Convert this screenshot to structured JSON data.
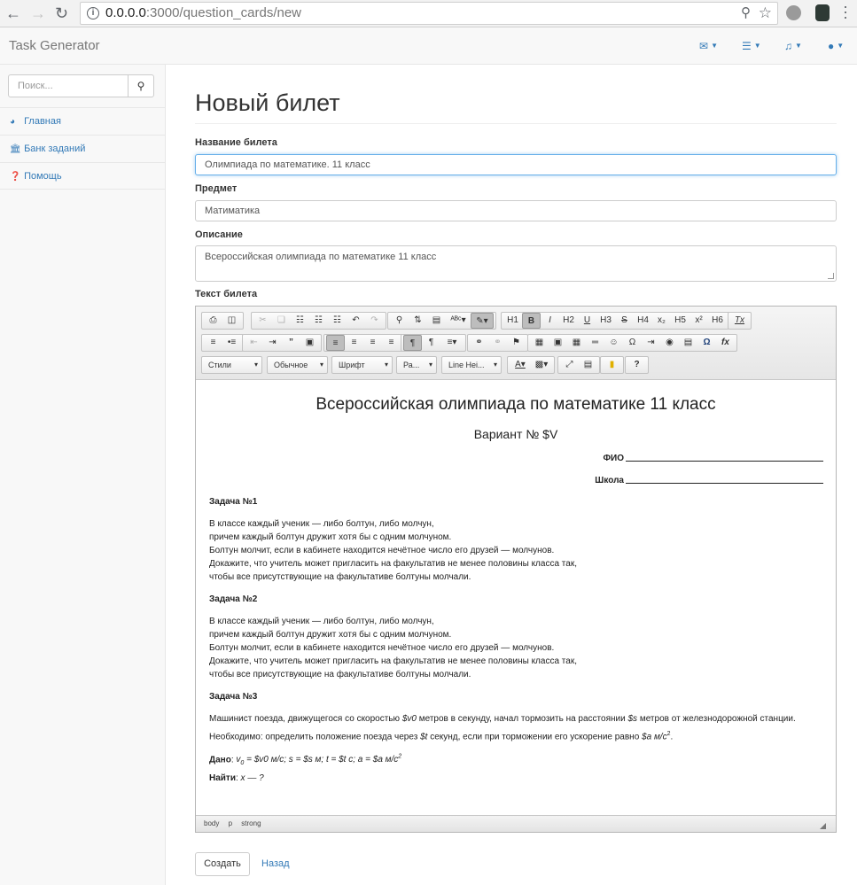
{
  "browser": {
    "url_host": "0.0.0.0",
    "url_path": ":3000/question_cards/new"
  },
  "navbar": {
    "brand": "Task Generator",
    "icons": [
      "envelope-icon",
      "tasks-icon",
      "bell-icon",
      "user-icon"
    ]
  },
  "sidebar": {
    "search_placeholder": "Поиск...",
    "items": [
      {
        "label": "Главная",
        "icon": "dashboard-icon"
      },
      {
        "label": "Банк заданий",
        "icon": "bank-icon"
      },
      {
        "label": "Помощь",
        "icon": "question-icon"
      }
    ]
  },
  "form": {
    "heading": "Новый билет",
    "name_label": "Название билета",
    "name_value": "Олимпиада по математике. 11 класс",
    "subject_label": "Предмет",
    "subject_value": "Матиматика",
    "description_label": "Описание",
    "description_value": "Всероссийская олимпиада по математике 11 класс",
    "text_label": "Текст билета",
    "submit_label": "Создать",
    "back_label": "Назад"
  },
  "editor": {
    "dropdowns": [
      "Стили",
      "Обычное",
      "Шрифт",
      "Ра...",
      "Line Hei..."
    ],
    "heading_buttons": [
      "H1",
      "B",
      "I",
      "H2",
      "U",
      "H3",
      "S",
      "H4",
      "x₂",
      "H5",
      "x²",
      "H6",
      "Tx"
    ],
    "path": [
      "body",
      "p",
      "strong"
    ],
    "doc": {
      "title": "Всероссийская олимпиада по математике 11 класс",
      "variant": "Вариант № $V",
      "fio_label": "ФИО",
      "school_label": "Школа",
      "task1_title": "Задача №1",
      "task1_text": "В классе каждый ученик — либо болтун, либо молчун,\nпричем каждый болтун дружит хотя бы с одним молчуном.\nБолтун молчит, если в кабинете находится нечётное число его друзей — молчунов.\nДокажите, что учитель может пригласить на факультатив не менее половины класса так,\nчтобы все присутствующие на факультативе болтуны молчали.",
      "task2_title": "Задача №2",
      "task2_text": "В классе каждый ученик — либо болтун, либо молчун,\nпричем каждый болтун дружит хотя бы с одним молчуном.\nБолтун молчит, если в кабинете находится нечётное число его друзей — молчунов.\nДокажите, что учитель может пригласить на факультатив не менее половины класса так,\nчтобы все присутствующие на факультативе болтуны молчали.",
      "task3_title": "Задача №3",
      "task3_line1_a": "Машинист поезда, движущегося со скоростью ",
      "task3_line1_b": "$v0",
      "task3_line1_c": " метров в секунду, начал тормозить на расстоянии ",
      "task3_line1_d": "$s",
      "task3_line1_e": " метров от железнодорожной станции.",
      "task3_line2_a": "Необходимо: определить положение поезда через ",
      "task3_line2_b": "$t",
      "task3_line2_c": " секунд, если при торможении его ускорение равно ",
      "task3_line2_d": "$a м/с",
      "given_label": "Дано",
      "given_text": "v",
      "given_rest": " = $v0 м/с; s = $s м; t = $t с; a = $a м/с",
      "find_label": "Найти",
      "find_text": "x — ?"
    }
  }
}
